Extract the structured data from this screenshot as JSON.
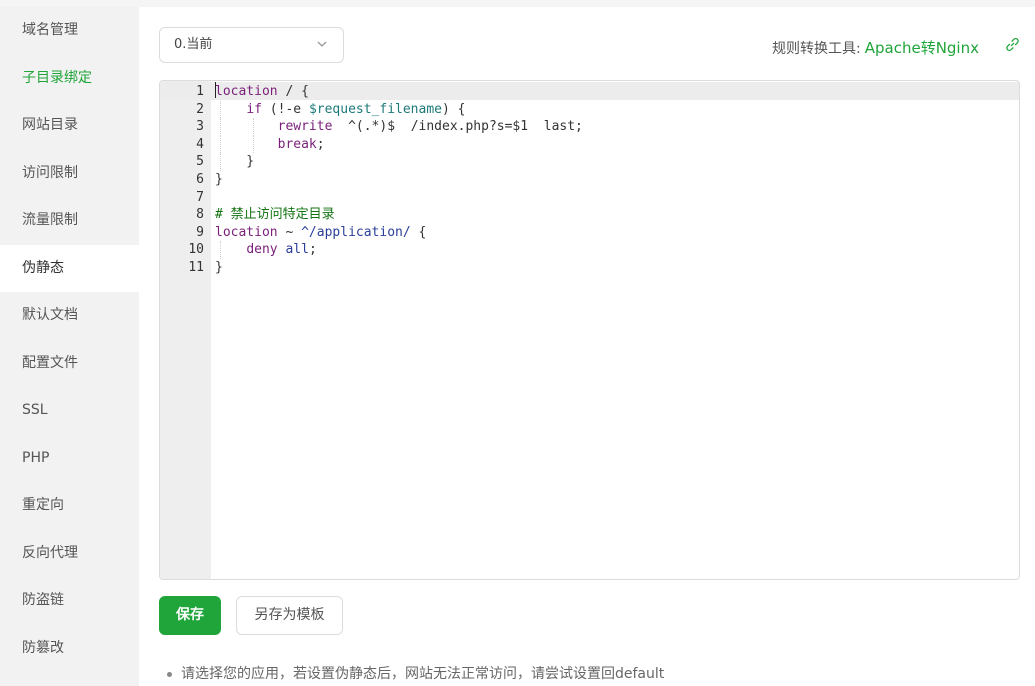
{
  "sidebar": {
    "items": [
      {
        "label": "域名管理"
      },
      {
        "label": "子目录绑定"
      },
      {
        "label": "网站目录"
      },
      {
        "label": "访问限制"
      },
      {
        "label": "流量限制"
      },
      {
        "label": "伪静态"
      },
      {
        "label": "默认文档"
      },
      {
        "label": "配置文件"
      },
      {
        "label": "SSL"
      },
      {
        "label": "PHP"
      },
      {
        "label": "重定向"
      },
      {
        "label": "反向代理"
      },
      {
        "label": "防盗链"
      },
      {
        "label": "防篡改"
      }
    ],
    "selected_index": 5,
    "highlighted_index": 1
  },
  "template_select": {
    "value": "0.当前",
    "icon": "chevron-down-icon"
  },
  "converter": {
    "label": "规则转换工具:",
    "link_text": "Apache转Nginx",
    "icon": "external-link-icon"
  },
  "editor": {
    "line_numbers": [
      "1",
      "2",
      "3",
      "4",
      "5",
      "6",
      "7",
      "8",
      "9",
      "10",
      "11"
    ]
  },
  "buttons": {
    "save": "保存",
    "save_as_template": "另存为模板"
  },
  "tip": "请选择您的应用，若设置伪静态后，网站无法正常访问，请尝试设置回default",
  "colors": {
    "accent_green": "#20a53a",
    "sidebar_bg": "#f2f2f2",
    "keyword": "#7a1f7a",
    "variable": "#1f7a7a",
    "path": "#2a3f9a",
    "comment": "#137313"
  }
}
